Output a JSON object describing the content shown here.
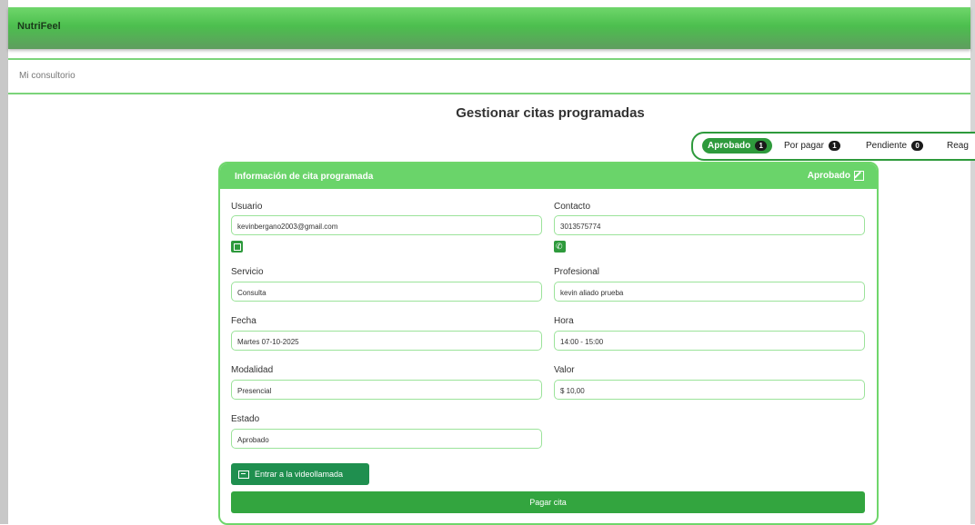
{
  "app": {
    "brand": "NutriFeel"
  },
  "breadcrumb": "Mi consultorio",
  "page_title": "Gestionar citas programadas",
  "status_filters": [
    {
      "label": "Aprobado",
      "count": "1",
      "active": true
    },
    {
      "label": "Por pagar",
      "count": "1",
      "active": false
    },
    {
      "label": "Pendiente",
      "count": "0",
      "active": false
    },
    {
      "label": "Reag",
      "count": "",
      "active": false
    }
  ],
  "card": {
    "title": "Información de cita programada",
    "status": "Aprobado"
  },
  "fields": {
    "usuario": {
      "label": "Usuario",
      "value": "kevinbergano2003@gmail.com"
    },
    "contacto": {
      "label": "Contacto",
      "value": "3013575774"
    },
    "servicio": {
      "label": "Servicio",
      "value": "Consulta"
    },
    "profesional": {
      "label": "Profesional",
      "value": "kevin aliado prueba"
    },
    "fecha": {
      "label": "Fecha",
      "value": "Martes 07-10-2025"
    },
    "hora": {
      "label": "Hora",
      "value": "14:00 - 15:00"
    },
    "modalidad": {
      "label": "Modalidad",
      "value": "Presencial"
    },
    "valor": {
      "label": "Valor",
      "value": "$ 10,00"
    },
    "estado": {
      "label": "Estado",
      "value": "Aprobado"
    }
  },
  "buttons": {
    "video": "Entrar a la videollamada",
    "pay": "Pagar cita"
  },
  "icons": {
    "usuario_action": "calendar-icon",
    "contacto_action": "phone-icon",
    "card_status": "edit-icon",
    "video": "video-icon"
  },
  "colors": {
    "brand_green": "#4cbf4e",
    "header_green": "#6ad46a",
    "button_green": "#33a53f",
    "video_button": "#1f8f4f"
  }
}
